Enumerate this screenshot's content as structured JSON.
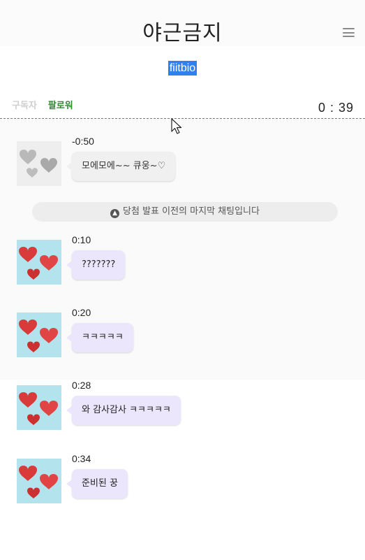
{
  "header": {
    "title": "야근금지",
    "menu_icon": "hamburger-menu-icon",
    "subtitle": "fiitbio"
  },
  "tabs": {
    "subscriber": "구독자",
    "follower": "팔로워"
  },
  "timer": "0 : 39",
  "notice": "당첨 발표 이전의 마지막 채팅입니다",
  "messages": [
    {
      "time": "-0:50",
      "text": "모에모에~~ 큐웅~♡"
    },
    {
      "time": "0:10",
      "text": "???????"
    },
    {
      "time": "0:20",
      "text": "ㅋㅋㅋㅋㅋ"
    },
    {
      "time": "0:28",
      "text": "와 감사감사 ㅋㅋㅋㅋㅋ"
    },
    {
      "time": "0:34",
      "text": "준비된 꿍"
    }
  ],
  "colors": {
    "accent": "#2f82ee",
    "follower": "#2f8a2f",
    "bubble": "#ebe6fb",
    "avatar_bg": "#b3e4ee",
    "heart": "#d93a3a"
  }
}
